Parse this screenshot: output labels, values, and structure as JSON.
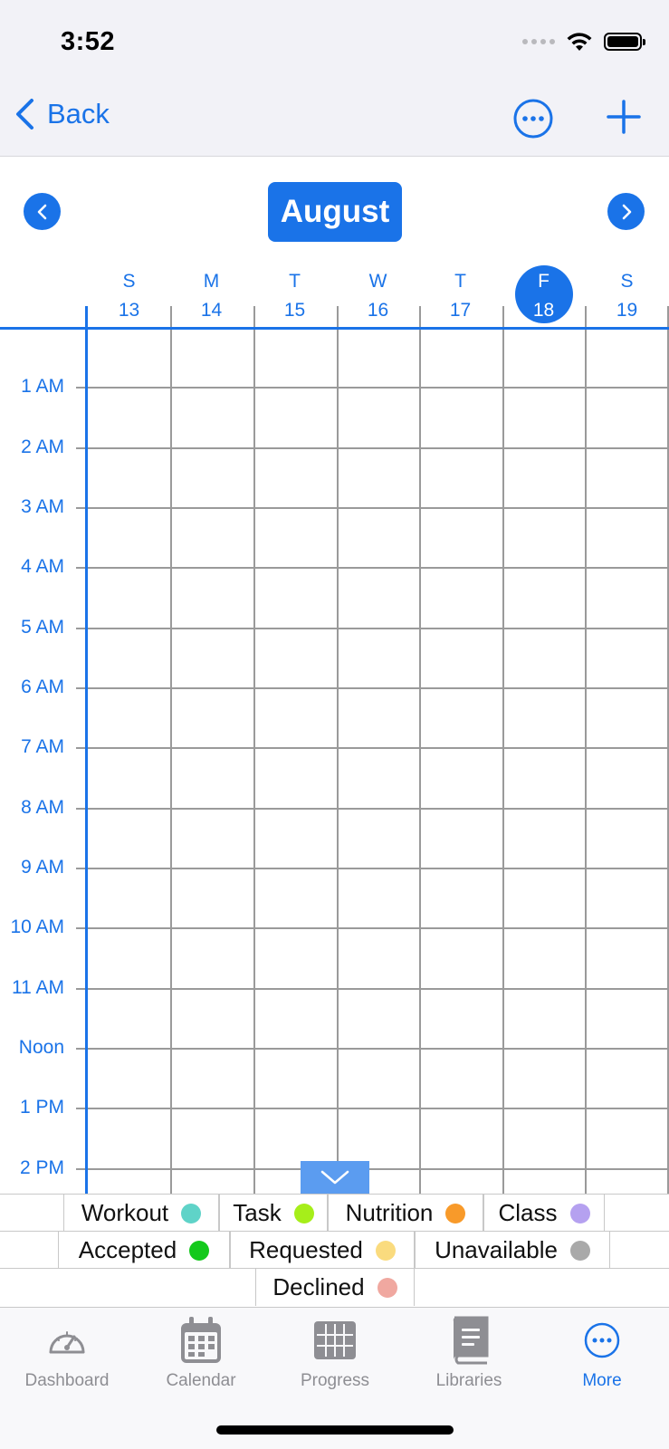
{
  "status_bar": {
    "time": "3:52"
  },
  "nav": {
    "back_label": "Back"
  },
  "calendar": {
    "month": "August",
    "days": [
      {
        "dow": "S",
        "num": "13"
      },
      {
        "dow": "M",
        "num": "14"
      },
      {
        "dow": "T",
        "num": "15"
      },
      {
        "dow": "W",
        "num": "16"
      },
      {
        "dow": "T",
        "num": "17"
      },
      {
        "dow": "F",
        "num": "18"
      },
      {
        "dow": "S",
        "num": "19"
      }
    ],
    "selected_day": "18",
    "hours": [
      "1 AM",
      "2 AM",
      "3 AM",
      "4 AM",
      "5 AM",
      "6 AM",
      "7 AM",
      "8 AM",
      "9 AM",
      "10 AM",
      "11 AM",
      "Noon",
      "1 PM",
      "2 PM"
    ]
  },
  "legend": {
    "rows": [
      [
        {
          "label": "Workout",
          "color": "#5fd3c8"
        },
        {
          "label": "Task",
          "color": "#a6ee1a"
        },
        {
          "label": "Nutrition",
          "color": "#f89a2a"
        },
        {
          "label": "Class",
          "color": "#b5a1f0"
        }
      ],
      [
        {
          "label": "Accepted",
          "color": "#14c91c"
        },
        {
          "label": "Requested",
          "color": "#fadb7e"
        },
        {
          "label": "Unavailable",
          "color": "#a9a9a9"
        }
      ],
      [
        {
          "label": "Declined",
          "color": "#f0a8a0"
        }
      ]
    ]
  },
  "tabbar": {
    "items": [
      {
        "label": "Dashboard",
        "icon": "gauge-icon"
      },
      {
        "label": "Calendar",
        "icon": "calendar-icon"
      },
      {
        "label": "Progress",
        "icon": "grid-icon"
      },
      {
        "label": "Libraries",
        "icon": "book-icon"
      },
      {
        "label": "More",
        "icon": "more-icon"
      }
    ],
    "active": "More"
  },
  "colors": {
    "accent": "#1a73e8",
    "grid_line": "#9a9a9a"
  }
}
